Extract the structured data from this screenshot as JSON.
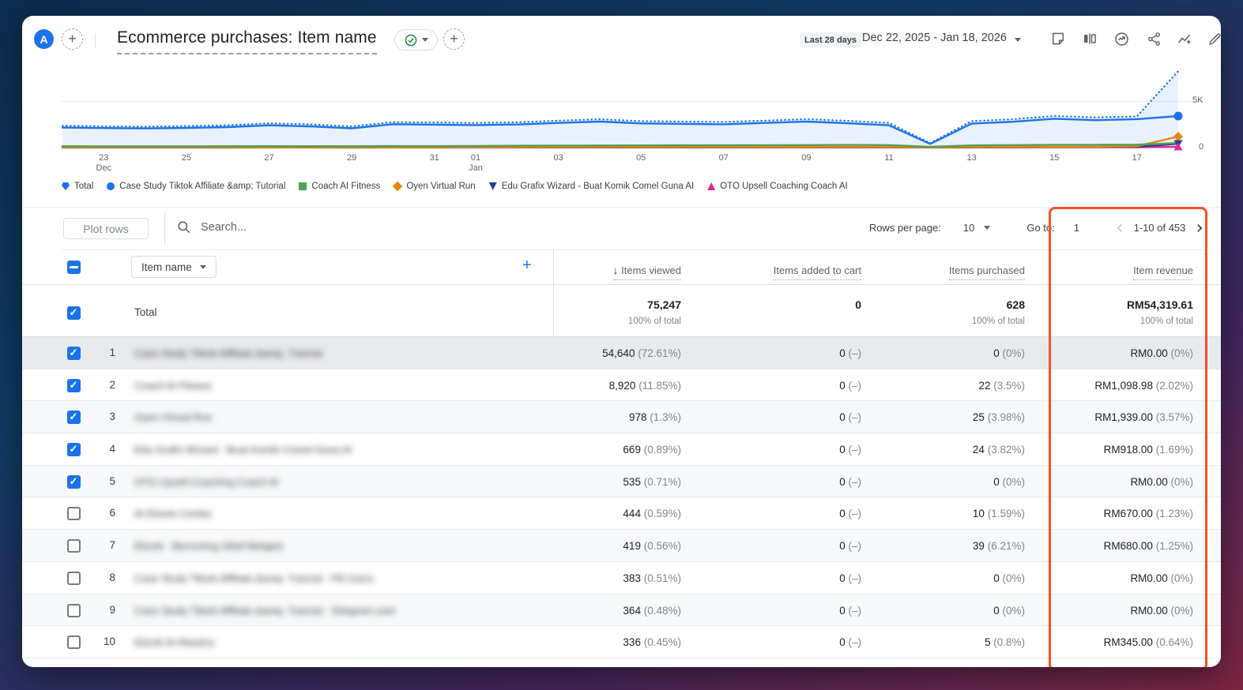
{
  "header": {
    "avatar_letter": "A",
    "title": "Ecommerce purchases: Item name",
    "add_comparison_label": "+",
    "add_report_label": "+",
    "date_range_label": "Last 28 days",
    "date_range": "Dec 22, 2025 - Jan 18, 2026",
    "toolbar_icons": [
      "notes-icon",
      "compare-reports-icon",
      "insights-circle-icon",
      "share-icon",
      "insights-sparkline-icon",
      "edit-icon"
    ]
  },
  "chart_data": {
    "type": "line",
    "title": "",
    "xlabel": "",
    "ylabel": "",
    "ylim": [
      0,
      5000
    ],
    "y_axis_side": "right",
    "y_tick_labels": [
      "5K",
      "0"
    ],
    "grid": "single horizontal gridline at 5K",
    "legend_position": "bottom",
    "x": [
      "Dec 22",
      "Dec 23",
      "Dec 24",
      "Dec 25",
      "Dec 26",
      "Dec 27",
      "Dec 28",
      "Dec 29",
      "Dec 30",
      "Dec 31",
      "Jan 01",
      "Jan 02",
      "Jan 03",
      "Jan 04",
      "Jan 05",
      "Jan 06",
      "Jan 07",
      "Jan 08",
      "Jan 09",
      "Jan 10",
      "Jan 11",
      "Jan 12",
      "Jan 13",
      "Jan 14",
      "Jan 15",
      "Jan 16",
      "Jan 17",
      "Jan 18"
    ],
    "x_ticks": [
      {
        "day": 1,
        "label": "23",
        "sub": "Dec"
      },
      {
        "day": 3,
        "label": "25",
        "sub": ""
      },
      {
        "day": 5,
        "label": "27",
        "sub": ""
      },
      {
        "day": 7,
        "label": "29",
        "sub": ""
      },
      {
        "day": 9,
        "label": "31",
        "sub": ""
      },
      {
        "day": 10,
        "label": "01",
        "sub": "Jan"
      },
      {
        "day": 12,
        "label": "03",
        "sub": ""
      },
      {
        "day": 14,
        "label": "05",
        "sub": ""
      },
      {
        "day": 16,
        "label": "07",
        "sub": ""
      },
      {
        "day": 18,
        "label": "09",
        "sub": ""
      },
      {
        "day": 20,
        "label": "11",
        "sub": ""
      },
      {
        "day": 22,
        "label": "13",
        "sub": ""
      },
      {
        "day": 24,
        "label": "15",
        "sub": ""
      },
      {
        "day": 26,
        "label": "17",
        "sub": ""
      }
    ],
    "series": [
      {
        "name": "Total",
        "color": "#1a73e8",
        "style": "dotted",
        "marker": "pentagon",
        "area_fill": "rgba(26,115,232,0.10)",
        "values": [
          2350,
          2300,
          2250,
          2320,
          2400,
          2620,
          2500,
          2280,
          2750,
          2700,
          2650,
          2720,
          2900,
          3050,
          2850,
          2800,
          2760,
          2900,
          3060,
          2880,
          2650,
          480,
          2850,
          3050,
          3400,
          3250,
          3350,
          8200
        ]
      },
      {
        "name": "Case Study Tiktok Affiliate &amp; Tutorial",
        "color": "#1a73e8",
        "style": "solid",
        "marker": "circle",
        "values": [
          2150,
          2100,
          2060,
          2120,
          2200,
          2400,
          2280,
          2080,
          2520,
          2470,
          2420,
          2480,
          2650,
          2800,
          2600,
          2550,
          2510,
          2650,
          2800,
          2620,
          2400,
          400,
          2580,
          2780,
          3100,
          2950,
          3060,
          3390
        ]
      },
      {
        "name": "Coach AI Fitness",
        "color": "#51a155",
        "style": "solid",
        "marker": "square",
        "values": [
          150,
          145,
          140,
          145,
          150,
          160,
          155,
          150,
          170,
          165,
          180,
          200,
          215,
          225,
          235,
          245,
          255,
          265,
          275,
          285,
          270,
          90,
          240,
          270,
          295,
          305,
          315,
          500
        ]
      },
      {
        "name": "Oyen Virtual Run",
        "color": "#e8860c",
        "style": "solid",
        "marker": "diamond",
        "values": [
          40,
          38,
          36,
          38,
          40,
          45,
          42,
          40,
          50,
          48,
          50,
          55,
          58,
          60,
          62,
          65,
          68,
          70,
          72,
          75,
          70,
          25,
          65,
          75,
          85,
          95,
          150,
          1190
        ]
      },
      {
        "name": "Edu Grafix Wizard - Buat Komik Comel Guna AI",
        "color": "#2f3a8f",
        "style": "solid",
        "marker": "tri-down",
        "values": [
          25,
          24,
          23,
          24,
          25,
          28,
          26,
          25,
          32,
          30,
          32,
          35,
          38,
          40,
          42,
          44,
          46,
          48,
          50,
          52,
          48,
          18,
          45,
          52,
          60,
          68,
          90,
          420
        ]
      },
      {
        "name": "OTO Upsell Coaching Coach AI",
        "color": "#e52592",
        "style": "solid",
        "marker": "tri-up",
        "values": [
          12,
          12,
          11,
          12,
          12,
          14,
          13,
          12,
          16,
          15,
          16,
          18,
          19,
          20,
          21,
          22,
          23,
          24,
          25,
          26,
          24,
          8,
          22,
          26,
          30,
          34,
          45,
          90
        ]
      }
    ]
  },
  "controls": {
    "plot_rows_label": "Plot rows",
    "search_placeholder": "Search...",
    "rows_per_page_label": "Rows per page:",
    "rows_per_page_value": "10",
    "go_to_label": "Go to:",
    "go_to_value": "1",
    "page_status": "1-10 of 453"
  },
  "table": {
    "dimension_header": "Item name",
    "add_metric_label": "+",
    "columns": [
      "Items viewed",
      "Items added to cart",
      "Items purchased",
      "Item revenue"
    ],
    "sorted_column": "Items viewed",
    "total": {
      "label": "Total",
      "viewed": "75,247",
      "viewed_sub": "100% of total",
      "cart": "0",
      "cart_sub": "",
      "purchased": "628",
      "purchased_sub": "100% of total",
      "revenue": "RM54,319.61",
      "revenue_sub": "100% of total"
    },
    "rows": [
      {
        "num": "1",
        "name": "Case Study Tiktok Affiliate &amp; Tutorial",
        "blurred": true,
        "checked": true,
        "highlighted": true,
        "viewed": "54,640",
        "viewed_pct": "(72.61%)",
        "cart": "0",
        "cart_pct": "(–)",
        "purchased": "0",
        "purchased_pct": "(0%)",
        "revenue": "RM0.00",
        "revenue_pct": "(0%)"
      },
      {
        "num": "2",
        "name": "Coach AI Fitness",
        "blurred": true,
        "checked": true,
        "viewed": "8,920",
        "viewed_pct": "(11.85%)",
        "cart": "0",
        "cart_pct": "(–)",
        "purchased": "22",
        "purchased_pct": "(3.5%)",
        "revenue": "RM1,098.98",
        "revenue_pct": "(2.02%)"
      },
      {
        "num": "3",
        "name": "Oyen Virtual Run",
        "blurred": true,
        "checked": true,
        "viewed": "978",
        "viewed_pct": "(1.3%)",
        "cart": "0",
        "cart_pct": "(–)",
        "purchased": "25",
        "purchased_pct": "(3.98%)",
        "revenue": "RM1,939.00",
        "revenue_pct": "(3.57%)"
      },
      {
        "num": "4",
        "name": "Edu Grafix Wizard - Buat Komik Comel Guna AI",
        "blurred": true,
        "checked": true,
        "viewed": "669",
        "viewed_pct": "(0.89%)",
        "cart": "0",
        "cart_pct": "(–)",
        "purchased": "24",
        "purchased_pct": "(3.82%)",
        "revenue": "RM918.00",
        "revenue_pct": "(1.69%)"
      },
      {
        "num": "5",
        "name": "OTO Upsell Coaching Coach AI",
        "blurred": true,
        "checked": true,
        "viewed": "535",
        "viewed_pct": "(0.71%)",
        "cart": "0",
        "cart_pct": "(–)",
        "purchased": "0",
        "purchased_pct": "(0%)",
        "revenue": "RM0.00",
        "revenue_pct": "(0%)"
      },
      {
        "num": "6",
        "name": "AI Ebook Combo",
        "blurred": true,
        "checked": false,
        "viewed": "444",
        "viewed_pct": "(0.59%)",
        "cart": "0",
        "cart_pct": "(–)",
        "purchased": "10",
        "purchased_pct": "(1.59%)",
        "revenue": "RM670.00",
        "revenue_pct": "(1.23%)"
      },
      {
        "num": "7",
        "name": "Ebook - Becoming (Abid Belajar)",
        "blurred": true,
        "checked": false,
        "viewed": "419",
        "viewed_pct": "(0.56%)",
        "cart": "0",
        "cart_pct": "(–)",
        "purchased": "39",
        "purchased_pct": "(6.21%)",
        "revenue": "RM680.00",
        "revenue_pct": "(1.25%)"
      },
      {
        "num": "8",
        "name": "Case Study Tiktok Affiliate &amp; Tutorial - FB Users",
        "blurred": true,
        "checked": false,
        "viewed": "383",
        "viewed_pct": "(0.51%)",
        "cart": "0",
        "cart_pct": "(–)",
        "purchased": "0",
        "purchased_pct": "(0%)",
        "revenue": "RM0.00",
        "revenue_pct": "(0%)"
      },
      {
        "num": "9",
        "name": "Case Study Tiktok Affiliate &amp; Tutorial - Telegram user",
        "blurred": true,
        "checked": false,
        "viewed": "364",
        "viewed_pct": "(0.48%)",
        "cart": "0",
        "cart_pct": "(–)",
        "purchased": "0",
        "purchased_pct": "(0%)",
        "revenue": "RM0.00",
        "revenue_pct": "(0%)"
      },
      {
        "num": "10",
        "name": "Ebook AI Mastery",
        "blurred": true,
        "checked": false,
        "viewed": "336",
        "viewed_pct": "(0.45%)",
        "cart": "0",
        "cart_pct": "(–)",
        "purchased": "5",
        "purchased_pct": "(0.8%)",
        "revenue": "RM345.00",
        "revenue_pct": "(0.64%)"
      }
    ]
  },
  "annotation": {
    "color": "#f95125",
    "purpose": "highlight of Item revenue column and pagination"
  },
  "colors": {
    "accent_blue": "#1a73e8",
    "text_primary": "#202124",
    "text_secondary": "#5f6368",
    "row_highlight": "#e9eaee",
    "row_alt": "#f8f9fa"
  }
}
